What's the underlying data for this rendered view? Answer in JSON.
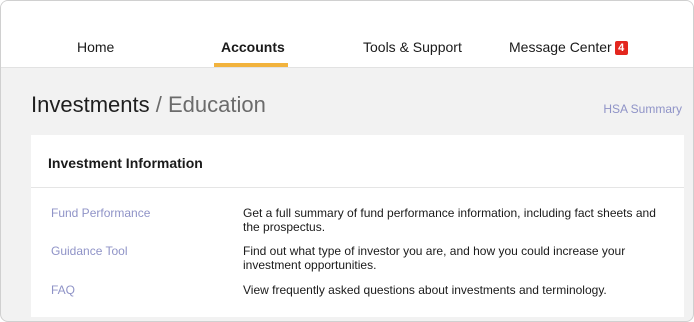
{
  "nav": {
    "items": [
      {
        "label": "Home"
      },
      {
        "label": "Accounts",
        "active": true
      },
      {
        "label": "Tools & Support"
      },
      {
        "label": "Message Center",
        "badge": "4"
      }
    ],
    "active_color": "#f2b33d",
    "badge_color": "#e3261e"
  },
  "page": {
    "title": "Investments",
    "separator": "/",
    "subtitle": "Education",
    "hsa_summary_link": "HSA Summary",
    "link_color": "#8f93c7"
  },
  "card": {
    "title": "Investment Information",
    "rows": [
      {
        "link": "Fund Performance",
        "description": "Get a full summary of fund performance information, including fact sheets and the prospectus."
      },
      {
        "link": "Guidance Tool",
        "description": "Find out what type of investor you are, and how you could increase your investment opportunities."
      },
      {
        "link": "FAQ",
        "description": "View frequently asked questions about investments and terminology."
      }
    ]
  }
}
